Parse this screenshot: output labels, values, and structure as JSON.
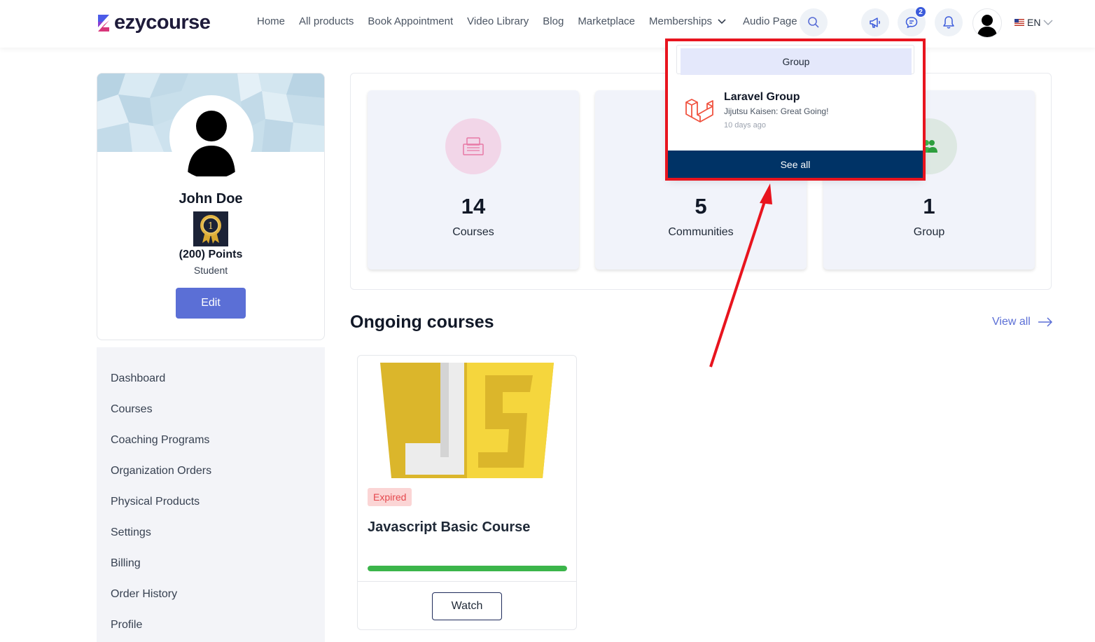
{
  "header": {
    "logo_text": "ezycourse",
    "nav": [
      "Home",
      "All products",
      "Book Appointment",
      "Video Library",
      "Blog",
      "Marketplace",
      "Memberships",
      "Audio Page"
    ],
    "messages_badge": "2",
    "language": "EN"
  },
  "profile": {
    "name": "John Doe",
    "medal_rank": "1",
    "points": "(200) Points",
    "role": "Student",
    "edit_label": "Edit"
  },
  "sidebar": {
    "items": [
      "Dashboard",
      "Courses",
      "Coaching Programs",
      "Organization Orders",
      "Physical Products",
      "Settings",
      "Billing",
      "Order History",
      "Profile"
    ]
  },
  "stats": [
    {
      "value": "14",
      "label": "Courses",
      "icon": "courses-icon",
      "color": "#f2d6e8"
    },
    {
      "value": "5",
      "label": "Communities",
      "icon": "communities-icon",
      "color": "#dfe6f5"
    },
    {
      "value": "1",
      "label": "Group",
      "icon": "group-icon",
      "color": "#dde8e2"
    }
  ],
  "ongoing": {
    "title": "Ongoing courses",
    "view_all": "View all",
    "course": {
      "status": "Expired",
      "title": "Javascript Basic Course",
      "progress": 1.0,
      "watch_label": "Watch"
    }
  },
  "dropdown": {
    "tab_label": "Group",
    "item_title": "Laravel Group",
    "item_subtitle": "Jijutsu Kaisen: Great Going!",
    "item_time": "10 days ago",
    "see_all": "See all"
  },
  "colors": {
    "accent": "#5b6fd6",
    "highlight": "#e8141e",
    "see_all_bg": "#003366",
    "progress": "#3bb54a"
  }
}
